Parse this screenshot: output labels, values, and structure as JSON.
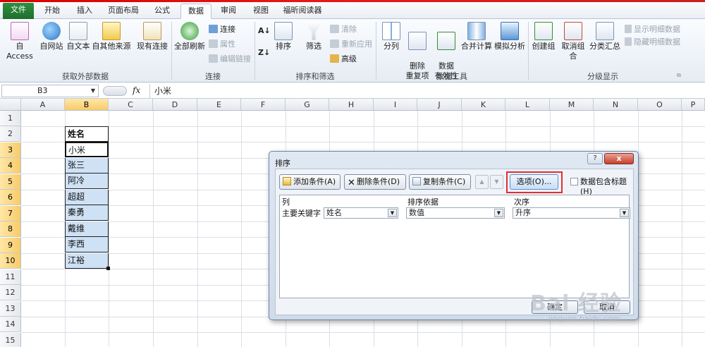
{
  "ribbon_tabs": [
    "文件",
    "开始",
    "插入",
    "页面布局",
    "公式",
    "数据",
    "审阅",
    "视图",
    "福昕阅读器"
  ],
  "active_tab": "数据",
  "groups": {
    "external": {
      "label": "获取外部数据",
      "buttons": [
        "自 Access",
        "自网站",
        "自文本",
        "自其他来源",
        "现有连接"
      ]
    },
    "connections": {
      "label": "连接",
      "refresh": "全部刷新",
      "items": [
        "连接",
        "属性",
        "编辑链接"
      ]
    },
    "sortfilter": {
      "label": "排序和筛选",
      "sort": "排序",
      "filter": "筛选",
      "items": [
        "清除",
        "重新应用",
        "高级"
      ]
    },
    "datatools": {
      "label": "数据工具",
      "buttons": [
        "分列",
        "删除\n重复项",
        "数据\n有效性",
        "合并计算",
        "模拟分析"
      ]
    },
    "outline": {
      "label": "分级显示",
      "buttons": [
        "创建组",
        "取消组合",
        "分类汇总"
      ],
      "items": [
        "显示明细数据",
        "隐藏明细数据"
      ]
    }
  },
  "formula_bar": {
    "name_box": "B3",
    "fx": "fx",
    "value": "小米"
  },
  "sheet": {
    "columns": [
      "A",
      "B",
      "C",
      "D",
      "E",
      "F",
      "G",
      "H",
      "I",
      "J",
      "K",
      "L",
      "M",
      "N",
      "O",
      "P"
    ],
    "rows": [
      "1",
      "2",
      "3",
      "4",
      "5",
      "6",
      "7",
      "8",
      "9",
      "10",
      "11",
      "12",
      "13",
      "14",
      "15"
    ],
    "cells": [
      "姓名",
      "小米",
      "张三",
      "阿冷",
      "超超",
      "秦勇",
      "戴维",
      "李西",
      "江裕"
    ]
  },
  "dialog": {
    "title": "排序",
    "help": "?",
    "close": "x",
    "add_condition": "添加条件(A)",
    "delete_condition": "删除条件(D)",
    "copy_condition": "复制条件(C)",
    "options": "选项(O)...",
    "has_header": "数据包含标题(H)",
    "col_header": "列",
    "basis_header": "排序依据",
    "order_header": "次序",
    "row_label": "主要关键字",
    "col_value": "姓名",
    "basis_value": "数值",
    "order_value": "升序",
    "ok": "确定",
    "cancel": "取消"
  },
  "watermark": {
    "main": "Bai 经验",
    "sub": "jingyan.baidu.com"
  },
  "colors": {
    "accent_red_frame": "#e03030",
    "file_tab": "#2a8a3a",
    "selection_fill": "#cfe1f5"
  }
}
